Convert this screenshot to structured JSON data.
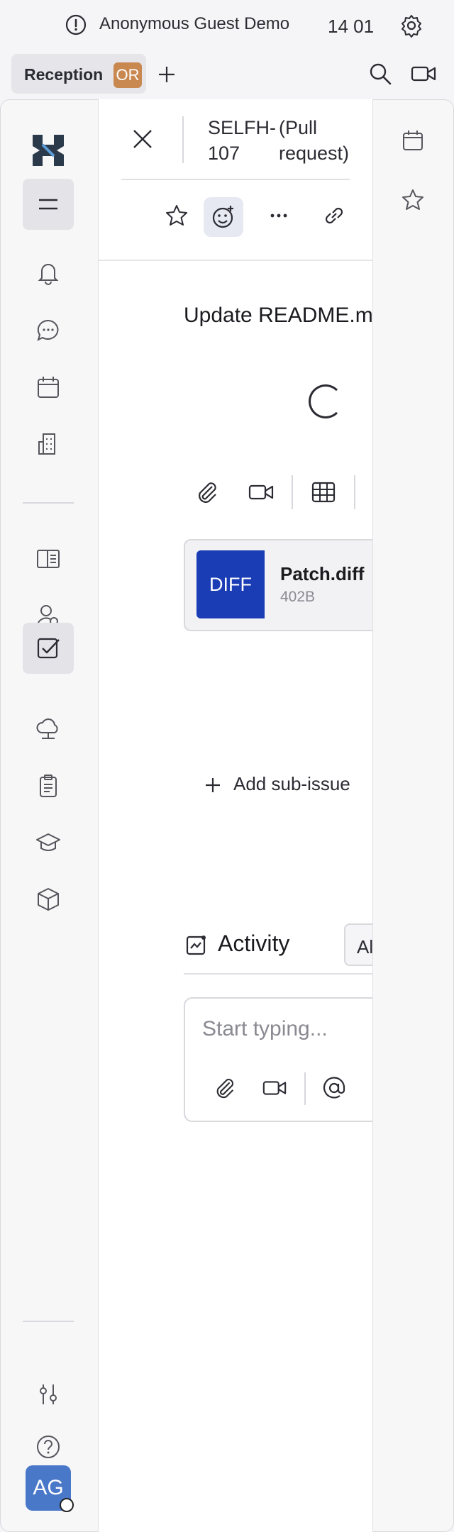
{
  "topbar": {
    "guest_label": "Anonymous Guest Demo",
    "clock": "14 01",
    "warning_icon": "alert-circle-icon",
    "settings_icon": "gear-icon"
  },
  "tabs": [
    {
      "label": "Reception",
      "badge": "OR",
      "badge_color": "#c98850"
    }
  ],
  "tabbar_icons": [
    "plus-icon",
    "search-icon",
    "video-icon"
  ],
  "sidebar": {
    "items": [
      {
        "name": "menu-icon",
        "active": true
      },
      {
        "name": "bell-icon"
      },
      {
        "name": "chat-icon"
      },
      {
        "name": "calendar-icon"
      },
      {
        "name": "office-building-icon"
      },
      {
        "name": "document-panel-icon"
      },
      {
        "name": "recruit-person-icon"
      },
      {
        "name": "tracker-checkbox-icon",
        "active": true
      },
      {
        "name": "cloud-drive-icon"
      },
      {
        "name": "clipboard-icon"
      },
      {
        "name": "education-cap-icon"
      },
      {
        "name": "box-package-icon"
      }
    ],
    "bottom": [
      "settings-sliders-icon",
      "help-icon"
    ],
    "avatar_initials": "AG"
  },
  "issue": {
    "id": "SELFH-107",
    "kind": "(Pull request)",
    "title": "Update README.md",
    "attachment": {
      "type": "DIFF",
      "name": "Patch.diff",
      "size": "402B"
    },
    "add_subissue_label": "Add sub-issue",
    "activity": {
      "title": "Activity",
      "filter": "All",
      "composer_placeholder": "Start typing..."
    }
  },
  "colors": {
    "accent": "#1a3cb5",
    "avatar": "#4a78c9",
    "badge": "#c98850",
    "active_bg": "#e4e4e8"
  }
}
